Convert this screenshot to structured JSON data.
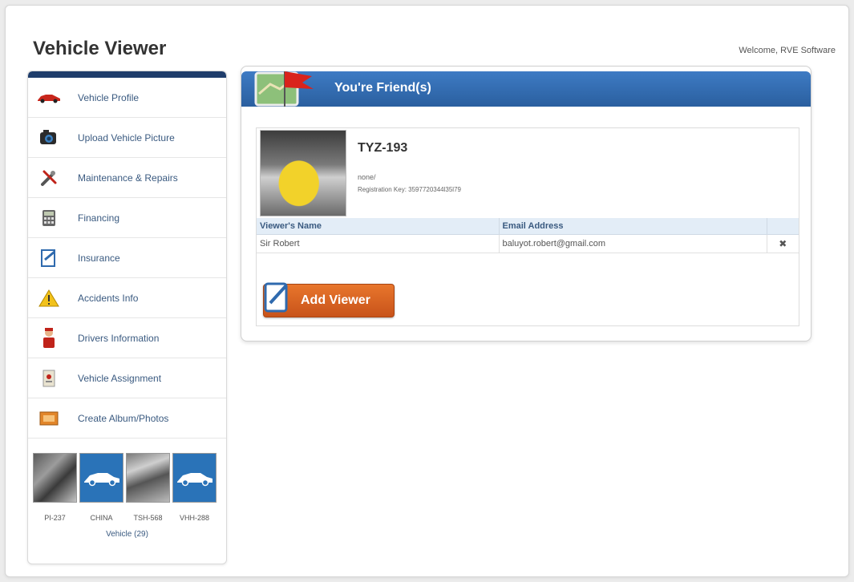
{
  "app": {
    "title": "Vehicle Viewer",
    "welcome": "Welcome, RVE Software"
  },
  "sidebar": {
    "items": [
      {
        "label": "Vehicle Profile",
        "icon": "car-icon"
      },
      {
        "label": "Upload Vehicle Picture",
        "icon": "camera-icon"
      },
      {
        "label": "Maintenance & Repairs",
        "icon": "tools-icon"
      },
      {
        "label": "Financing",
        "icon": "calculator-icon"
      },
      {
        "label": "Insurance",
        "icon": "insurance-form-icon"
      },
      {
        "label": "Accidents Info",
        "icon": "warning-icon"
      },
      {
        "label": "Drivers Information",
        "icon": "driver-icon"
      },
      {
        "label": "Vehicle Assignment",
        "icon": "assignment-icon"
      },
      {
        "label": "Create Album/Photos",
        "icon": "album-icon"
      }
    ],
    "vehicles": [
      {
        "label": "PI-237"
      },
      {
        "label": "CHINA"
      },
      {
        "label": "TSH-568"
      },
      {
        "label": "VHH-288"
      }
    ],
    "vehicle_count": "Vehicle (29)"
  },
  "panel": {
    "title": "You're Friend(s)",
    "vehicle": {
      "plate": "TYZ-193",
      "owner": "none/",
      "registration": "Registration Key: 3597720344l35l79"
    },
    "table": {
      "headers": [
        "Viewer's Name",
        "Email Address",
        ""
      ],
      "rows": [
        {
          "name": "Sir Robert",
          "email": "baluyot.robert@gmail.com"
        }
      ]
    },
    "add_button": "Add Viewer"
  },
  "colors": {
    "header_blue": "#2f6aae",
    "sidebar_top": "#1f3d6b",
    "button_orange": "#d9621f",
    "delete_red": "#c0231a"
  }
}
